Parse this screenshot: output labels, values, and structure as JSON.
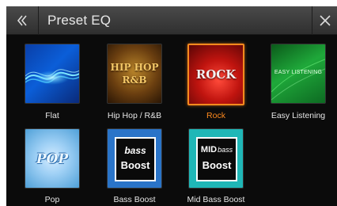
{
  "header": {
    "title": "Preset EQ",
    "back_icon": "double-chevron-left-icon",
    "close_icon": "close-icon"
  },
  "presets": [
    {
      "label": "Flat",
      "selected": false,
      "art_text": ""
    },
    {
      "label": "Hip Hop / R&B",
      "selected": false,
      "art_text_line1": "HIP HOP",
      "art_text_line2": "R&B"
    },
    {
      "label": "Rock",
      "selected": true,
      "art_text": "ROCK"
    },
    {
      "label": "Easy Listening",
      "selected": false,
      "art_text": "EASY LISTENING"
    },
    {
      "label": "Pop",
      "selected": false,
      "art_text": "POP"
    },
    {
      "label": "Bass Boost",
      "selected": false,
      "art_text_line1": "bass",
      "art_text_line2": "Boost"
    },
    {
      "label": "Mid Bass Boost",
      "selected": false,
      "art_text_line1a": "MID",
      "art_text_line1b": "bass",
      "art_text_line2": "Boost"
    }
  ],
  "colors": {
    "accent": "#ff8a1e",
    "background": "#0b0b0b",
    "header": "#3a3a3a"
  }
}
